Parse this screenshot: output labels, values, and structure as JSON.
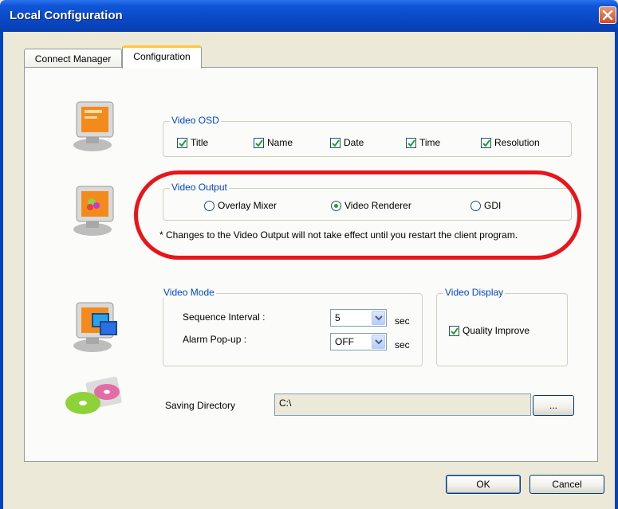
{
  "window": {
    "title": "Local Configuration"
  },
  "tabs": [
    {
      "label": "Connect Manager",
      "active": false
    },
    {
      "label": "Configuration",
      "active": true
    }
  ],
  "video_osd": {
    "legend": "Video OSD",
    "items": [
      {
        "label": "Title",
        "checked": true
      },
      {
        "label": "Name",
        "checked": true
      },
      {
        "label": "Date",
        "checked": true
      },
      {
        "label": "Time",
        "checked": true
      },
      {
        "label": "Resolution",
        "checked": true
      }
    ]
  },
  "video_output": {
    "legend": "Video Output",
    "options": [
      {
        "label": "Overlay Mixer",
        "selected": false
      },
      {
        "label": "Video Renderer",
        "selected": true
      },
      {
        "label": "GDI",
        "selected": false
      }
    ],
    "note": "* Changes to the Video Output will not take effect until you restart the client program."
  },
  "video_mode": {
    "legend": "Video Mode",
    "sequence_interval_label": "Sequence Interval :",
    "sequence_interval_value": "5",
    "alarm_popup_label": "Alarm Pop-up :",
    "alarm_popup_value": "OFF",
    "unit": "sec"
  },
  "video_display": {
    "legend": "Video Display",
    "quality_improve_label": "Quality Improve",
    "quality_improve_checked": true
  },
  "saving_directory": {
    "label": "Saving Directory",
    "value": "C:\\",
    "browse_label": "..."
  },
  "buttons": {
    "ok": "OK",
    "cancel": "Cancel"
  },
  "colors": {
    "highlight_oval": "#e8151b",
    "title_bar": "#0a48c8",
    "legend_text": "#0046d5"
  },
  "icons": [
    "monitor-osd-icon",
    "monitor-output-icon",
    "monitor-mode-icon",
    "disc-icon",
    "close-icon",
    "check-icon",
    "dropdown-arrow-icon"
  ]
}
